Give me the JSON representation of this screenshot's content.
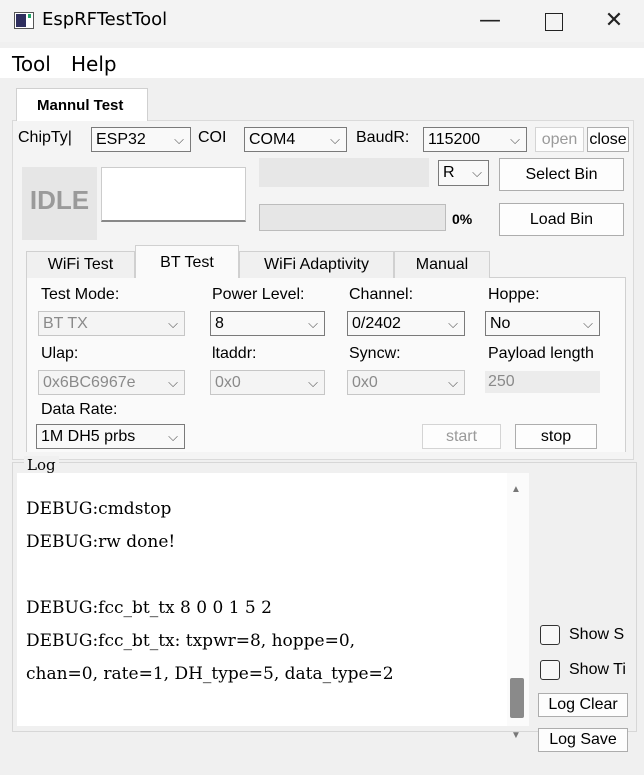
{
  "window": {
    "title": "EspRFTestTool",
    "minimize": "—",
    "close": "✕"
  },
  "menu": [
    "Tool",
    "Help"
  ],
  "outer_tab": "Mannul Test",
  "connection": {
    "chip_label": "ChipTy|",
    "chip_value": "ESP32",
    "com_label": "COI",
    "com_value": "COM4",
    "baud_label": "BaudR:",
    "baud_value": "115200",
    "open_label": "open",
    "close_label": "close"
  },
  "status": {
    "state": "IDLE",
    "mode_value": "R",
    "select_bin": "Select Bin",
    "load_bin": "Load Bin",
    "progress_text": "0%",
    "progress_value": 0
  },
  "inner_tabs": [
    "WiFi Test",
    "BT Test",
    "WiFi Adaptivity",
    "Manual"
  ],
  "active_tab": "BT Test",
  "bt": {
    "test_mode_label": "Test Mode:",
    "test_mode_value": "BT TX",
    "power_label": "Power Level:",
    "power_value": "8",
    "channel_label": "Channel:",
    "channel_value": "0/2402",
    "hoppe_label": "Hoppe:",
    "hoppe_value": "No",
    "ulap_label": "Ulap:",
    "ulap_value": "0x6BC6967e",
    "ltaddr_label": "ltaddr:",
    "ltaddr_value": "0x0",
    "syncw_label": "Syncw:",
    "syncw_value": "0x0",
    "payload_label": "Payload length",
    "payload_value": "250",
    "data_rate_label": "Data Rate:",
    "data_rate_value": "1M  DH5  prbs",
    "start_label": "start",
    "stop_label": "stop"
  },
  "log": {
    "legend": "Log",
    "lines": [
      "DEBUG:cmdstop",
      "DEBUG:rw done!",
      "",
      "DEBUG:fcc_bt_tx 8 0 0 1 5 2",
      "DEBUG:fcc_bt_tx: txpwr=8, hoppe=0,",
      "chan=0, rate=1, DH_type=5, data_type=2"
    ],
    "show_s": "Show S",
    "show_t": "Show Ti",
    "clear": "Log Clear",
    "save": "Log Save"
  },
  "icons": {
    "arrow": "⌵",
    "scroll_up": "▲",
    "scroll_down": "▼"
  }
}
